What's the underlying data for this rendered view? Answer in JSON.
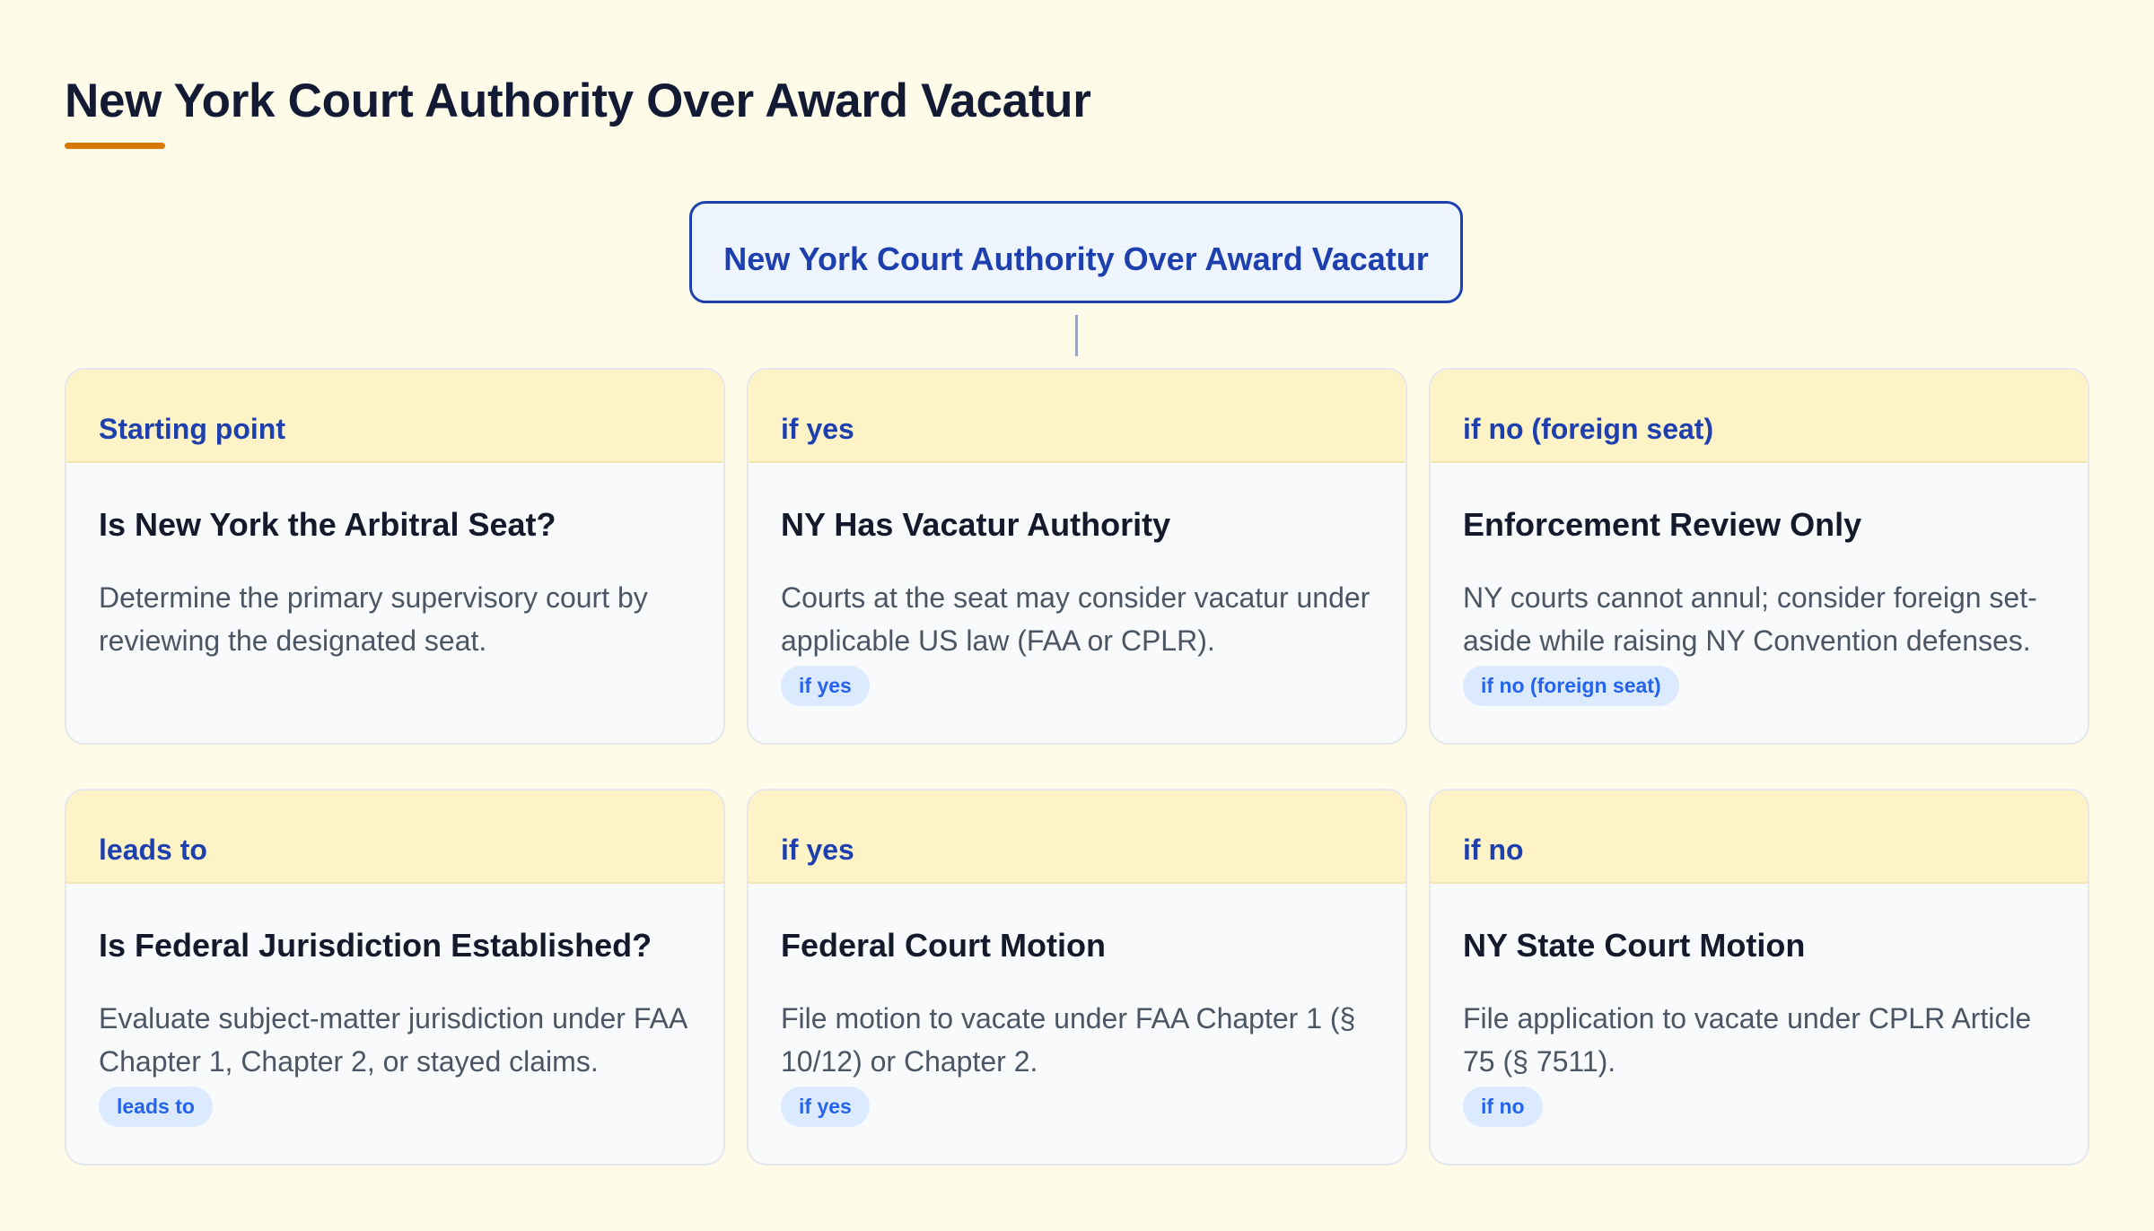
{
  "page": {
    "title": "New York Court Authority Over Award Vacatur"
  },
  "root_node": {
    "label": "New York Court Authority Over Award Vacatur"
  },
  "cards": [
    {
      "header": "Starting point",
      "title": "Is New York the Arbitral Seat?",
      "description": "Determine the primary supervisory court by reviewing the designated seat.",
      "tag": ""
    },
    {
      "header": "if yes",
      "title": "NY Has Vacatur Authority",
      "description": "Courts at the seat may consider vacatur under applicable US law (FAA or CPLR).",
      "tag": "if yes"
    },
    {
      "header": "if no (foreign seat)",
      "title": "Enforcement Review Only",
      "description": "NY courts cannot annul; consider foreign set-aside while raising NY Convention defenses.",
      "tag": "if no (foreign seat)"
    },
    {
      "header": "leads to",
      "title": "Is Federal Jurisdiction Established?",
      "description": "Evaluate subject-matter jurisdiction under FAA Chapter 1, Chapter 2, or stayed claims.",
      "tag": "leads to"
    },
    {
      "header": "if yes",
      "title": "Federal Court Motion",
      "description": "File motion to vacate under FAA Chapter 1 (§ 10/12) or Chapter 2.",
      "tag": "if yes"
    },
    {
      "header": "if no",
      "title": "NY State Court Motion",
      "description": "File application to vacate under CPLR Article 75 (§ 7511).",
      "tag": "if no"
    }
  ],
  "colors": {
    "background": "#fefbe9",
    "accent": "#d97706",
    "primary": "#1e40af",
    "card_header": "#fef3c7",
    "tag_background": "#dbeafe"
  }
}
